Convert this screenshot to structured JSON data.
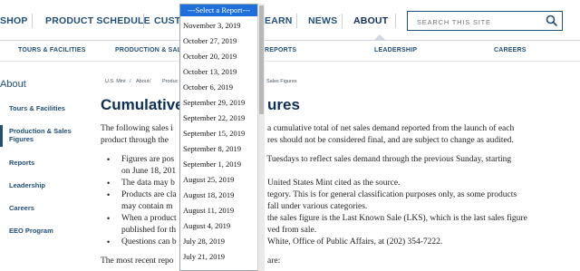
{
  "topnav": {
    "items": [
      "SHOP",
      "PRODUCT SCHEDULE",
      "CUSTO",
      "EARN",
      "NEWS",
      "ABOUT"
    ],
    "search_placeholder": "SEARCH THIS SITE"
  },
  "subnav": {
    "items": [
      "TOURS & FACILITIES",
      "PRODUCTION & SALE",
      "REPORTS",
      "LEADERSHIP",
      "CAREERS"
    ]
  },
  "sidebar": {
    "title": "About",
    "items": [
      "Tours & Facilities",
      "Production & Sales Figures",
      "Reports",
      "Leadership",
      "Careers",
      "EEO Program"
    ]
  },
  "breadcrumb": {
    "parts": [
      "U.S. Mint",
      "/",
      "About",
      "/",
      "Produc",
      "Sales Figures"
    ]
  },
  "main": {
    "title_left": "Cumulative",
    "title_right": "ures",
    "lines": [
      "The following sales i",
      "a cumulative total of net sales demand reported from the launch of each",
      "product through the",
      "res should not be considered final, and are subject to change as audited.",
      "Figures are pos",
      ") Tuesdays to reflect sales demand through the previous Sunday, starting",
      "on June 18, 201",
      "The data may b",
      "United States Mint cited as the source.",
      "Products are cla",
      "tegory. This is for general classification purposes only, as some products",
      "may contain m",
      "fall under various categories.",
      "When a product",
      "the sales figure is the Last Known Sale (LKS), which is the last sales figure",
      "published for th",
      "ved from sale.",
      "Questions can b",
      "White, Office of Public Affairs, at (202) 354-7222.",
      "The most recent repo",
      "are:"
    ]
  },
  "dropdown": {
    "header": "---Select a Report---",
    "options": [
      "November 3, 2019",
      "October 27, 2019",
      "October 20, 2019",
      "October 13, 2019",
      "October 6, 2019",
      "September 29, 2019",
      "September 22, 2019",
      "September 15, 2019",
      "September 8, 2019",
      "September 1, 2019",
      "August 25, 2019",
      "August 18, 2019",
      "August 11, 2019",
      "August 4, 2019",
      "July 28, 2019",
      "July 21, 2019"
    ]
  },
  "colors": {
    "brand_navy": "#1f4e79",
    "dropdown_highlight": "#1e6fd9"
  }
}
